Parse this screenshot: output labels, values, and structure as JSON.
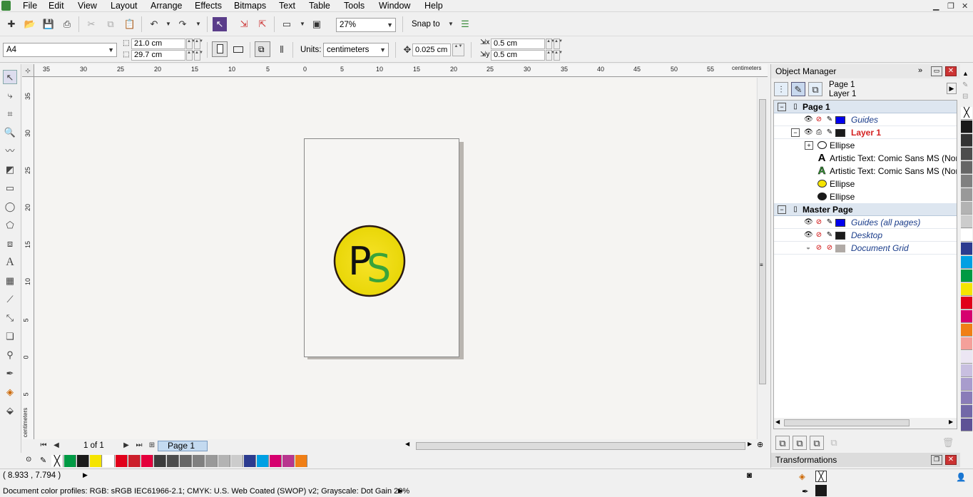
{
  "menu": [
    "File",
    "Edit",
    "View",
    "Layout",
    "Arrange",
    "Effects",
    "Bitmaps",
    "Text",
    "Table",
    "Tools",
    "Window",
    "Help"
  ],
  "toolbar": {
    "zoom": "27%",
    "snap_label": "Snap to"
  },
  "property_bar": {
    "paper": "A4",
    "width": "21.0 cm",
    "height": "29.7 cm",
    "units_label": "Units:",
    "units": "centimeters",
    "nudge": "0.025 cm",
    "dup_x": "0.5 cm",
    "dup_y": "0.5 cm"
  },
  "rulers": {
    "unit": "centimeters",
    "h_ticks": [
      "35",
      "30",
      "25",
      "20",
      "15",
      "10",
      "5",
      "0",
      "5",
      "10",
      "15",
      "20",
      "25",
      "30",
      "35",
      "40",
      "45",
      "50",
      "55"
    ],
    "v_ticks": [
      "35",
      "30",
      "25",
      "20",
      "15",
      "10",
      "5",
      "0",
      "5"
    ]
  },
  "logo": {
    "letter1": "P",
    "letter2": "S",
    "fill": "#f2e21a",
    "letter1_color": "#111111",
    "letter2_color": "#3aa33a"
  },
  "page_nav": {
    "counter": "1 of 1",
    "tab": "Page 1"
  },
  "palette": [
    "#009a44",
    "#1a1a1a",
    "#f5e400",
    "#ffffff",
    "#e1001a",
    "#cc1f2b",
    "#e4003c",
    "#3c3c3c",
    "#4d4d4d",
    "#666666",
    "#808080",
    "#999999",
    "#b3b3b3",
    "#cccccc",
    "#2c3b8f",
    "#00a0e3",
    "#d6006f",
    "#b8368e",
    "#f07f16"
  ],
  "status": {
    "coords": "( 8.933 , 7.794 )",
    "profiles": "Document color profiles: RGB: sRGB IEC61966-2.1; CMYK: U.S. Web Coated (SWOP) v2; Grayscale: Dot Gain 20%"
  },
  "object_manager": {
    "title": "Object Manager",
    "current_page": "Page 1",
    "current_layer": "Layer 1",
    "rows": [
      {
        "label": "Page 1",
        "kind": "group"
      },
      {
        "label": "Guides",
        "kind": "layer",
        "color": "#0000ee"
      },
      {
        "label": "Layer 1",
        "kind": "layer-active",
        "color": "#1a1a1a"
      },
      {
        "label": "Ellipse",
        "kind": "object",
        "icon": "ellipse-outline"
      },
      {
        "label": "Artistic Text: Comic Sans MS (Nor",
        "kind": "object",
        "icon": "text-black"
      },
      {
        "label": "Artistic Text: Comic Sans MS (Nor",
        "kind": "object",
        "icon": "text-green"
      },
      {
        "label": "Ellipse",
        "kind": "object",
        "icon": "ellipse-yellow"
      },
      {
        "label": "Ellipse",
        "kind": "object",
        "icon": "ellipse-black"
      },
      {
        "label": "Master Page",
        "kind": "group"
      },
      {
        "label": "Guides (all pages)",
        "kind": "layer",
        "color": "#0000ee"
      },
      {
        "label": "Desktop",
        "kind": "layer",
        "color": "#1a1a1a"
      },
      {
        "label": "Document Grid",
        "kind": "layer",
        "color": "#b0aaa6"
      }
    ]
  },
  "transformations": {
    "title": "Transformations"
  },
  "right_palette": [
    "#1a1a1a",
    "#333333",
    "#4d4d4d",
    "#666666",
    "#808080",
    "#999999",
    "#b3b3b3",
    "#cccccc",
    "#ffffff",
    "#2c3b8f",
    "#00a0e3",
    "#009a44",
    "#f5e400",
    "#e1001a",
    "#d6006f",
    "#f07f16",
    "#f4a09a",
    "#ece6f3",
    "#c8bfe0",
    "#a89ccd",
    "#8a7cb8",
    "#7268a8",
    "#5e5296"
  ]
}
